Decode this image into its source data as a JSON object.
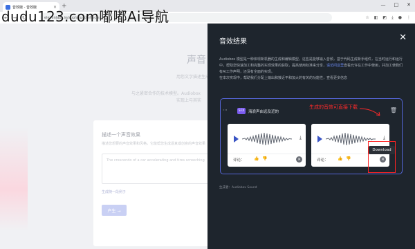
{
  "browser": {
    "tab_title": "音效版 - 音效版",
    "url": "elevenlabs.io/app/sound-effects",
    "controls": [
      "—",
      "□",
      "✕"
    ]
  },
  "watermark": "dudu123.com嘟嘟Ai导航",
  "background": {
    "title": "声音",
    "subtitle_1": "用您文字描述生成",
    "subtitle_2": "与之紧密合作的技术模型。Audiobox",
    "subtitle_3": "实现上与其实",
    "form_heading": "描述一个声音效果",
    "form_hint": "描述您想要的声音效果和风格，它能帮您生成逼真或创意的声音效果",
    "textarea_placeholder": "The crescendo of a car accelerating and tires screeching",
    "example_link": "生成随一段例子",
    "generate_button": "产生 →"
  },
  "panel": {
    "title": "音效结果",
    "close_icon": "close-icon",
    "description_1": "Audiobox 模型是一种体现新机器的生成和编辑模型。这些是能够输入音频，基于代码生成新手组件，在当时运行和运行中，帮助您快速加工和完整的实现效果的获取，提高使用标准来分享，",
    "description_link": "请访问这里",
    "description_2": "查看允许在工作中使用，并加工使我们有AI工作声明，还没有全面的实现。",
    "description_3": "在本次实现中，帮助我们分配上输出和接近平和加大的有关的功能性，查看更多信息",
    "result": {
      "prompt": "海浪声由远及近的",
      "badge": "SFX",
      "annotation": "生成的音效可直接下载",
      "tooltip": "Download",
      "cards": [
        {
          "rate_label": "评论：",
          "thumb_up": "👍",
          "thumb_down": "👎"
        },
        {
          "rate_label": "评论：",
          "thumb_up": "👍",
          "thumb_down": "👎"
        }
      ]
    },
    "footer": "生成者：Audiobox Sound"
  }
}
